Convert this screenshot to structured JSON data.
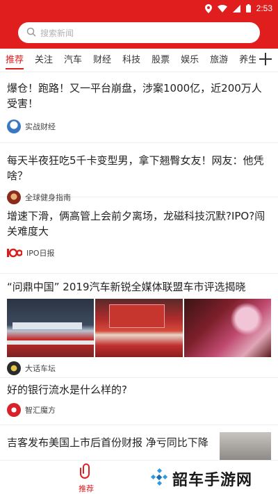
{
  "status_bar": {
    "time": "2:53"
  },
  "search": {
    "placeholder": "搜索新闻"
  },
  "tabs": [
    {
      "label": "推荐",
      "active": true
    },
    {
      "label": "关注"
    },
    {
      "label": "汽车"
    },
    {
      "label": "财经"
    },
    {
      "label": "科技"
    },
    {
      "label": "股票"
    },
    {
      "label": "娱乐"
    },
    {
      "label": "旅游"
    },
    {
      "label": "养生"
    }
  ],
  "feed": {
    "articles": [
      {
        "title": "爆仓！跑路！又一平台崩盘，涉案1000亿，近200万人受害！",
        "source": "实战财经"
      },
      {
        "title": "每天半夜狂吃5千卡变型男，拿下翘臀女友！网友：他凭啥？",
        "source": "全球健身指南"
      },
      {
        "title": "增速下滑，俩高管上会前夕离场，龙磁科技沉默?IPO?闯关难度大",
        "source": "IPO日报"
      },
      {
        "title": "“问鼎中国” 2019汽车新锐全媒体联盟车市评选揭晓",
        "source": "大话车坛"
      },
      {
        "title": "好的银行流水是什么样的?",
        "source": "智汇魔方"
      },
      {
        "title": "吉客发布美国上市后首份财报 净亏同比下降"
      }
    ]
  },
  "bottom_bar": {
    "recommend_label": "推荐",
    "brand_text": "韶车手游网"
  },
  "colors": {
    "accent": "#e01e1e"
  }
}
